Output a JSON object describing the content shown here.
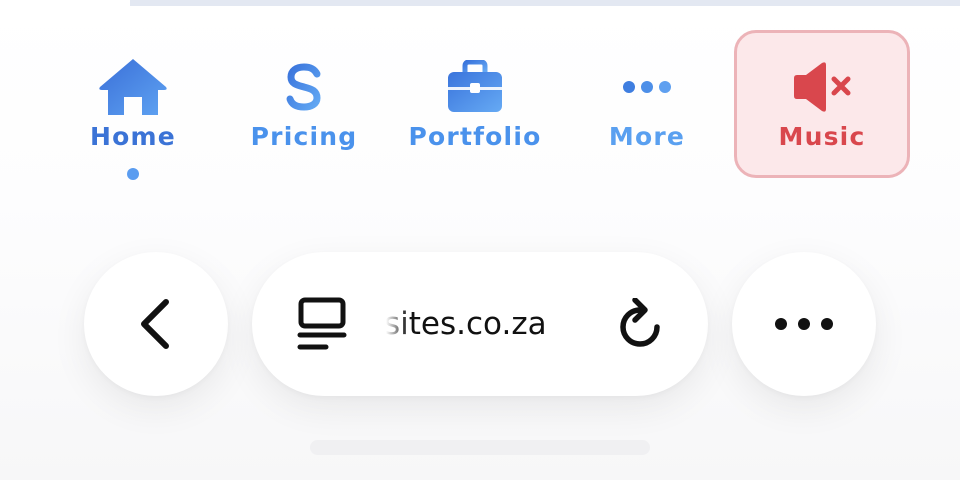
{
  "nav": {
    "items": [
      {
        "label": "Home",
        "icon": "house-icon",
        "active": true
      },
      {
        "label": "Pricing",
        "icon": "dollar-icon"
      },
      {
        "label": "Portfolio",
        "icon": "briefcase-icon"
      },
      {
        "label": "More",
        "icon": "ellipsis-icon"
      },
      {
        "label": "Music",
        "icon": "speaker-muted-icon",
        "state": "muted"
      }
    ]
  },
  "toolbar": {
    "url": "sites.co.za",
    "back_icon": "chevron-left-icon",
    "reader_icon": "reader-mode-icon",
    "reload_icon": "reload-icon",
    "menu_icon": "ellipsis-icon"
  },
  "colors": {
    "nav_blue": "#3b73d6",
    "nav_blue_light": "#4a92ec",
    "music_red": "#d9474d",
    "music_bg": "#fce8ea",
    "music_border": "#ecb3b8"
  }
}
